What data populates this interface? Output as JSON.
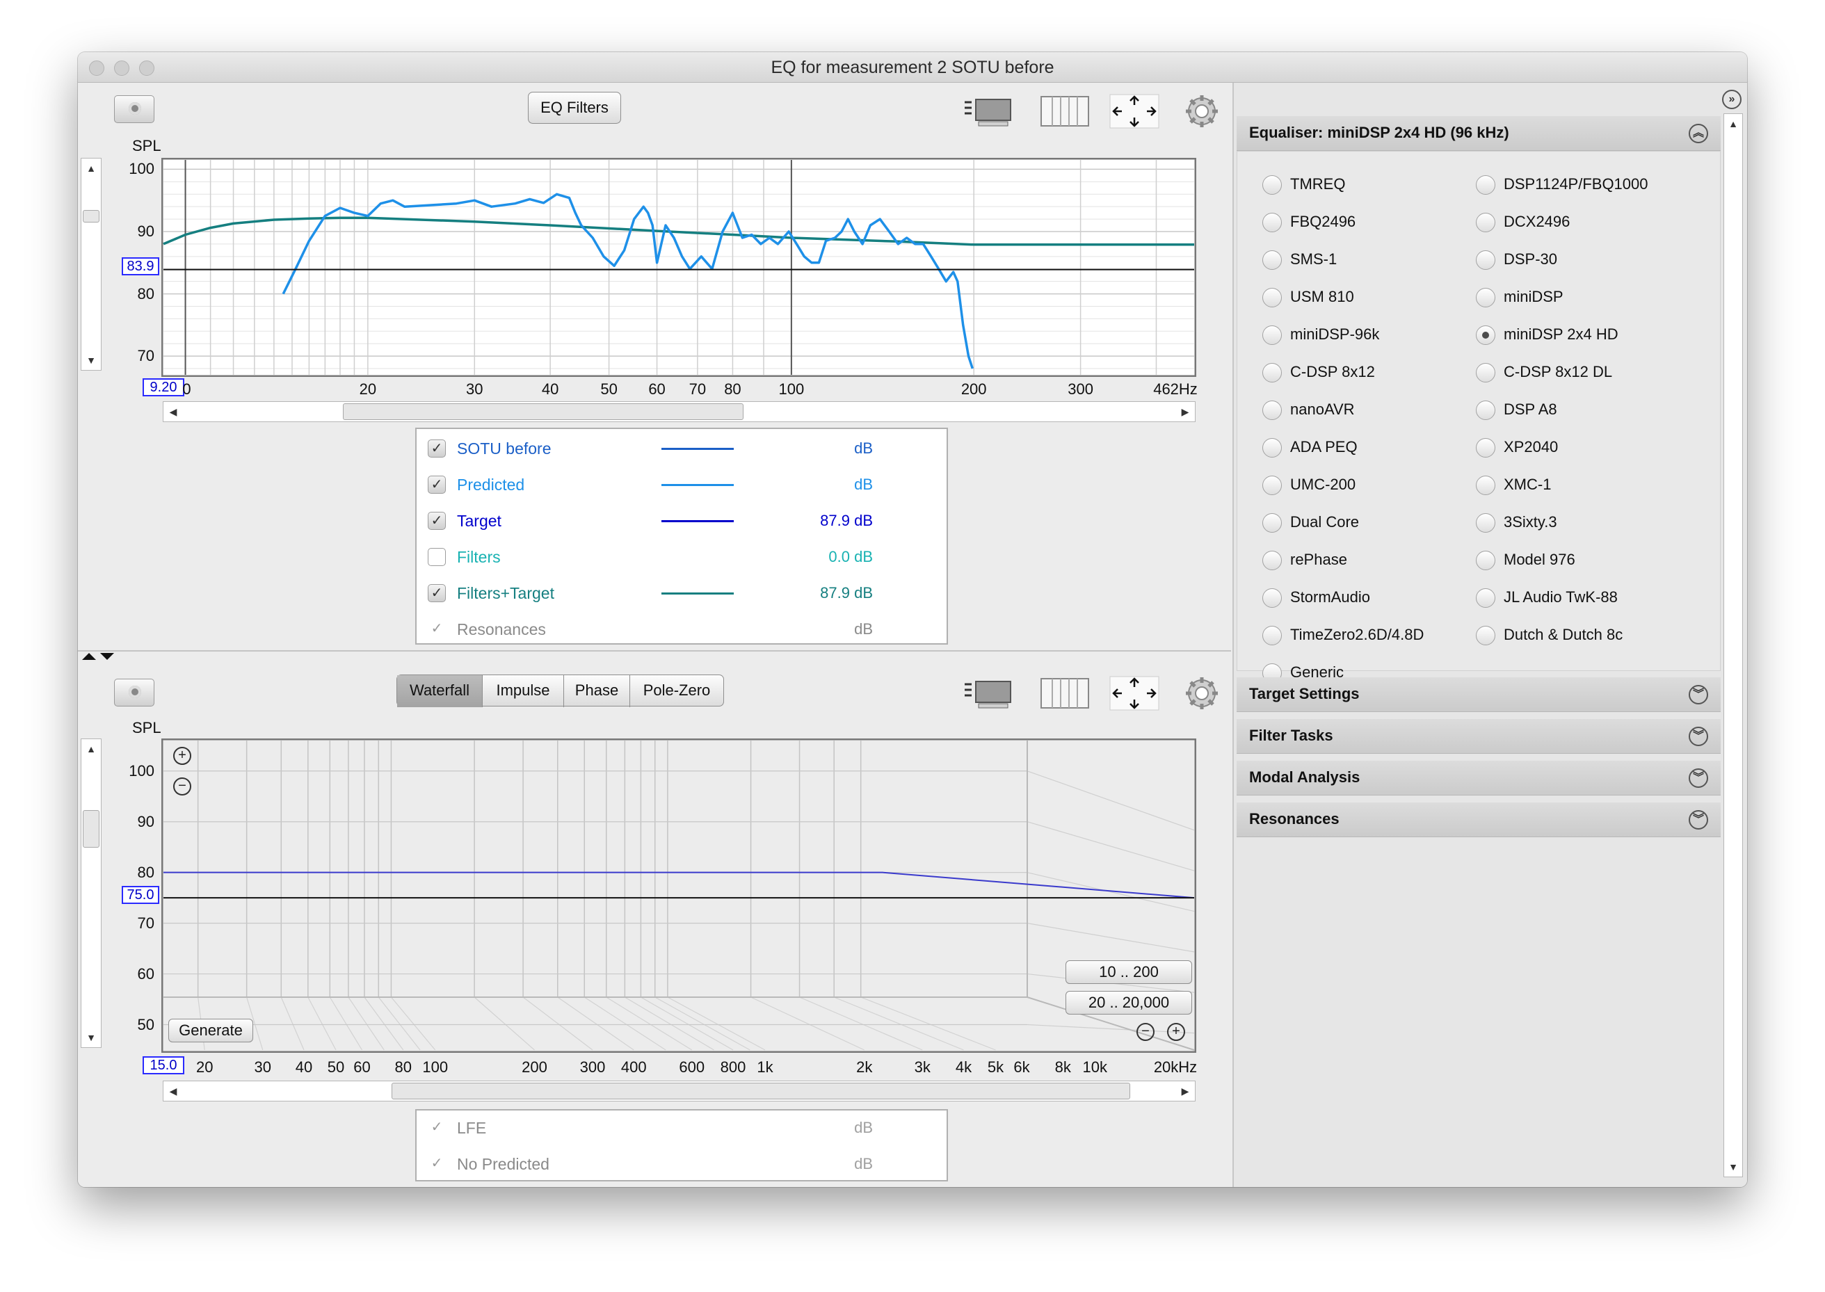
{
  "window": {
    "title": "EQ for measurement 2 SOTU before"
  },
  "toolbar": {
    "eq_filters_label": "EQ Filters"
  },
  "top_chart": {
    "y_title": "SPL",
    "y_ticks": [
      "100",
      "90",
      "80",
      "70"
    ],
    "y_tick_values": [
      100,
      90,
      80,
      70
    ],
    "y_range": [
      67,
      101.5
    ],
    "cursor_level": "83.9",
    "cursor_value": 83.9,
    "x_start": "9.20",
    "x_ticks": [
      "0",
      "20",
      "30",
      "40",
      "50",
      "60",
      "70",
      "80",
      "100",
      "200",
      "300",
      "462Hz"
    ],
    "x_tick_values": [
      10,
      20,
      30,
      40,
      50,
      60,
      70,
      80,
      100,
      200,
      300,
      462
    ],
    "x_range": [
      9.2,
      462
    ],
    "log_x": true
  },
  "chart_data": [
    {
      "type": "line",
      "title": "",
      "xlabel": "",
      "ylabel": "SPL",
      "xlim": [
        9.2,
        462
      ],
      "ylim": [
        67,
        101.5
      ],
      "x_scale": "log",
      "series": [
        {
          "name": "SOTU before",
          "color": "#1e90e8",
          "points": [
            [
              14.5,
              80
            ],
            [
              15.2,
              84
            ],
            [
              16,
              88.5
            ],
            [
              17,
              92.5
            ],
            [
              18,
              93.8
            ],
            [
              19,
              93
            ],
            [
              20,
              92.5
            ],
            [
              21,
              94.5
            ],
            [
              22,
              95
            ],
            [
              23,
              94
            ],
            [
              25,
              94.2
            ],
            [
              28,
              94.5
            ],
            [
              30,
              95
            ],
            [
              32,
              94
            ],
            [
              35,
              94.5
            ],
            [
              37,
              95.2
            ],
            [
              39,
              94.6
            ],
            [
              41,
              96
            ],
            [
              43,
              95.4
            ],
            [
              44,
              93
            ],
            [
              45,
              91
            ],
            [
              47,
              89
            ],
            [
              49,
              86
            ],
            [
              51,
              84.5
            ],
            [
              53,
              87
            ],
            [
              55,
              92
            ],
            [
              57,
              94
            ],
            [
              58,
              93
            ],
            [
              59,
              91
            ],
            [
              60,
              85
            ],
            [
              62,
              91
            ],
            [
              64,
              89
            ],
            [
              66,
              86
            ],
            [
              68,
              84
            ],
            [
              71,
              86
            ],
            [
              74,
              84
            ],
            [
              77,
              90
            ],
            [
              80,
              93
            ],
            [
              83,
              89
            ],
            [
              86,
              89.5
            ],
            [
              89,
              88
            ],
            [
              92,
              89
            ],
            [
              95,
              88
            ],
            [
              99,
              90
            ],
            [
              102,
              88
            ],
            [
              105,
              86
            ],
            [
              108,
              85
            ],
            [
              111,
              85
            ],
            [
              114,
              88.5
            ],
            [
              118,
              89
            ],
            [
              121,
              90
            ],
            [
              124,
              92
            ],
            [
              127,
              90
            ],
            [
              131,
              88
            ],
            [
              135,
              91
            ],
            [
              140,
              92
            ],
            [
              145,
              90
            ],
            [
              150,
              88
            ],
            [
              155,
              89
            ],
            [
              160,
              88
            ],
            [
              165,
              88
            ],
            [
              170,
              86
            ],
            [
              175,
              84
            ],
            [
              180,
              82
            ],
            [
              185,
              83.5
            ],
            [
              188,
              82
            ],
            [
              192,
              75
            ],
            [
              196,
              70
            ],
            [
              199,
              68
            ]
          ]
        },
        {
          "name": "Filters+Target",
          "color": "#157f80",
          "points": [
            [
              9.2,
              88
            ],
            [
              10,
              89.5
            ],
            [
              11,
              90.6
            ],
            [
              12,
              91.3
            ],
            [
              14,
              91.9
            ],
            [
              16,
              92.1
            ],
            [
              18,
              92.2
            ],
            [
              20,
              92.2
            ],
            [
              30,
              91.6
            ],
            [
              40,
              91
            ],
            [
              60,
              90.1
            ],
            [
              80,
              89.5
            ],
            [
              100,
              89
            ],
            [
              150,
              88.4
            ],
            [
              200,
              87.9
            ],
            [
              300,
              87.9
            ],
            [
              462,
              87.9
            ]
          ]
        },
        {
          "name": "Target",
          "color": "#0000cc",
          "points": [
            [
              9.2,
              83.9
            ],
            [
              462,
              83.9
            ]
          ]
        }
      ]
    },
    {
      "type": "line",
      "title": "",
      "xlabel": "",
      "ylabel": "SPL",
      "xlim": [
        15,
        20000
      ],
      "ylim": [
        45,
        106
      ],
      "x_scale": "log",
      "series": [
        {
          "name": "LFE",
          "color": "#3a3acc",
          "points": [
            [
              15,
              80
            ],
            [
              6000,
              80
            ],
            [
              20000,
              75
            ]
          ]
        }
      ]
    }
  ],
  "legend_top": [
    {
      "label": "SOTU before",
      "value": "dB",
      "checked": true,
      "color": "#1b5fc7",
      "line_color": "#1b5fc7"
    },
    {
      "label": "Predicted",
      "value": "dB",
      "checked": true,
      "color": "#1e90e8",
      "line_color": "#1e90e8"
    },
    {
      "label": "Target",
      "value": "87.9 dB",
      "checked": true,
      "color": "#0000cc",
      "line_color": "#0000cc"
    },
    {
      "label": "Filters",
      "value": "0.0 dB",
      "checked": false,
      "color": "#18b2b2",
      "line_color": ""
    },
    {
      "label": "Filters+Target",
      "value": "87.9 dB",
      "checked": true,
      "color": "#157f80",
      "line_color": "#157f80"
    },
    {
      "label": "Resonances",
      "value": "dB",
      "checked": true,
      "color": "#8a8a8a",
      "line_color": "",
      "disabled": true
    }
  ],
  "bottom_tabs": [
    "Waterfall",
    "Impulse",
    "Phase",
    "Pole-Zero"
  ],
  "bottom_chart": {
    "y_title": "SPL",
    "y_ticks": [
      "100",
      "90",
      "80",
      "70",
      "60",
      "50"
    ],
    "y_tick_values": [
      100,
      90,
      80,
      70,
      60,
      50
    ],
    "cursor_level": "75.0",
    "cursor_value": 75,
    "x_start": "15.0",
    "x_ticks": [
      "20",
      "30",
      "40",
      "50",
      "60",
      "80",
      "100",
      "200",
      "300",
      "400",
      "600",
      "800",
      "1k",
      "2k",
      "3k",
      "4k",
      "5k",
      "6k",
      "8k",
      "10k",
      "20kHz"
    ],
    "x_tick_values": [
      20,
      30,
      40,
      50,
      60,
      80,
      100,
      200,
      300,
      400,
      600,
      800,
      1000,
      2000,
      3000,
      4000,
      5000,
      6000,
      8000,
      10000,
      20000
    ],
    "generate_label": "Generate",
    "range_btn_1": "10 .. 200",
    "range_btn_2": "20 .. 20,000"
  },
  "legend_bottom": [
    {
      "label": "LFE",
      "value": "dB"
    },
    {
      "label": "No Predicted",
      "value": "dB"
    }
  ],
  "right_panel": {
    "equaliser_header": "Equaliser: miniDSP 2x4 HD (96 kHz)",
    "equalisers_left": [
      "TMREQ",
      "FBQ2496",
      "SMS-1",
      "USM 810",
      "miniDSP-96k",
      "C-DSP 8x12",
      "nanoAVR",
      "ADA PEQ",
      "UMC-200",
      "Dual Core",
      "rePhase",
      "StormAudio",
      "TimeZero2.6D/4.8D",
      "Generic"
    ],
    "equalisers_right": [
      "DSP1124P/FBQ1000",
      "DCX2496",
      "DSP-30",
      "miniDSP",
      "miniDSP 2x4 HD",
      "C-DSP 8x12 DL",
      "DSP A8",
      "XP2040",
      "XMC-1",
      "3Sixty.3",
      "Model 976",
      "JL Audio TwK-88",
      "Dutch & Dutch 8c"
    ],
    "selected": "miniDSP 2x4 HD",
    "sections": [
      "Target Settings",
      "Filter Tasks",
      "Modal Analysis",
      "Resonances"
    ]
  }
}
